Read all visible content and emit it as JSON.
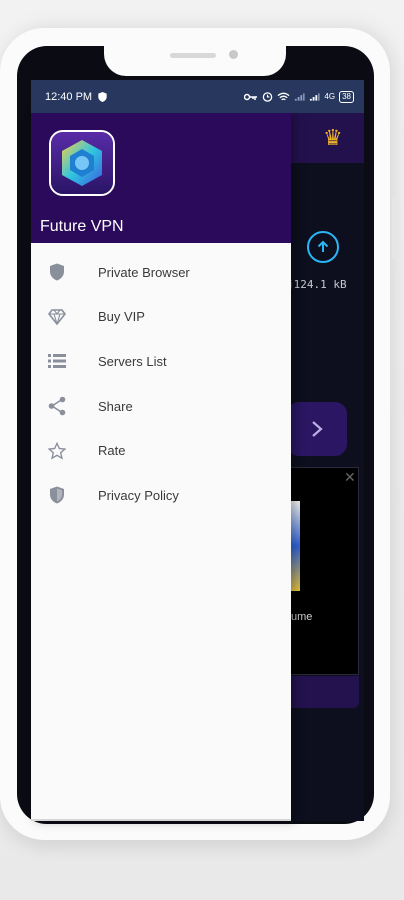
{
  "status_bar": {
    "time": "12:40 PM",
    "battery": "38"
  },
  "drawer": {
    "app_name": "Future VPN",
    "items": [
      {
        "label": "Private Browser",
        "icon": "shield-icon"
      },
      {
        "label": "Buy VIP",
        "icon": "diamond-icon"
      },
      {
        "label": "Servers List",
        "icon": "list-icon"
      },
      {
        "label": "Share",
        "icon": "share-icon"
      },
      {
        "label": "Rate",
        "icon": "star-icon"
      },
      {
        "label": "Privacy Policy",
        "icon": "privacy-shield-icon"
      }
    ]
  },
  "background_app": {
    "speed_text": "j124.1 kB",
    "ad_text": "ume"
  },
  "colors": {
    "drawer_header": "#2b0a5c",
    "status_bar": "#27375e",
    "upload_accent": "#29b6f6",
    "crown": "#f0b429"
  }
}
